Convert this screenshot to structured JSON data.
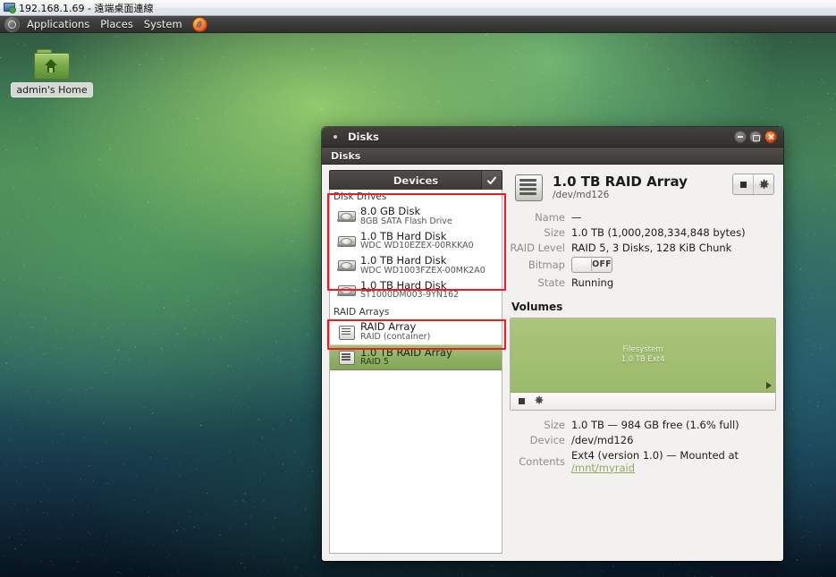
{
  "rdp": {
    "title": "192.168.1.69 - 遠端桌面連線",
    "icon": "remote-desktop-icon"
  },
  "desktop": {
    "menubar": {
      "logo_icon": "ubuntu-logo-icon",
      "items": [
        {
          "label": "Applications"
        },
        {
          "label": "Places"
        },
        {
          "label": "System"
        }
      ],
      "launcher_icon": "firefox-icon"
    },
    "home_icon": {
      "label": "admin's Home",
      "icon": "home-folder-icon"
    }
  },
  "window": {
    "title": "Disks",
    "menu_icon": "window-menu-icon",
    "buttons": {
      "minimize": "minimize-icon",
      "maximize": "maximize-icon",
      "close": "close-icon"
    },
    "app_header": "Disks"
  },
  "sidebar": {
    "header_label": "Devices",
    "header_check_icon": "check-icon",
    "groups": [
      {
        "title": "Disk Drives",
        "items": [
          {
            "name": "8.0 GB Disk",
            "model": "8GB SATA Flash Drive",
            "icon": "hard-disk-icon",
            "selected": false
          },
          {
            "name": "1.0 TB Hard Disk",
            "model": "WDC WD10EZEX-00RKKA0",
            "icon": "hard-disk-icon",
            "selected": false
          },
          {
            "name": "1.0 TB Hard Disk",
            "model": "WDC WD1003FZEX-00MK2A0",
            "icon": "hard-disk-icon",
            "selected": false
          },
          {
            "name": "1.0 TB Hard Disk",
            "model": "ST1000DM003-9YN162",
            "icon": "hard-disk-icon",
            "selected": false
          }
        ]
      },
      {
        "title": "RAID Arrays",
        "items": [
          {
            "name": "RAID Array",
            "model": "RAID (container)",
            "icon": "raid-array-icon",
            "selected": false
          },
          {
            "name": "1.0 TB RAID Array",
            "model": "RAID 5",
            "icon": "raid-array-icon",
            "selected": true
          }
        ]
      }
    ]
  },
  "detail": {
    "icon": "raid-array-icon",
    "title": "1.0 TB RAID Array",
    "subtitle": "/dev/md126",
    "actions": [
      {
        "name": "stop-array-button",
        "icon": "stop-square-icon"
      },
      {
        "name": "array-options-button",
        "icon": "gear-icon"
      }
    ],
    "properties": [
      {
        "label": "Name",
        "value": "—"
      },
      {
        "label": "Size",
        "value": "1.0 TB (1,000,208,334,848 bytes)"
      },
      {
        "label": "RAID Level",
        "value": "RAID 5, 3 Disks, 128 KiB Chunk"
      },
      {
        "label": "Bitmap",
        "value": "OFF",
        "type": "toggle"
      },
      {
        "label": "State",
        "value": "Running"
      }
    ]
  },
  "volumes": {
    "title": "Volumes",
    "strip": {
      "line1": "Filesystem",
      "line2": "1.0 TB Ext4",
      "color": "#a3c073"
    },
    "toolbar": [
      {
        "name": "unmount-volume-button",
        "icon": "stop-square-icon"
      },
      {
        "name": "volume-options-button",
        "icon": "gear-icon"
      }
    ],
    "properties": [
      {
        "label": "Size",
        "value": "1.0 TB — 984 GB free (1.6% full)"
      },
      {
        "label": "Device",
        "value": "/dev/md126"
      },
      {
        "label": "Contents",
        "value": "Ext4 (version 1.0) — Mounted at ",
        "link": "/mnt/myraid"
      }
    ]
  },
  "annotations": {
    "color": "#ed1c24",
    "boxes": [
      {
        "name": "disk-drives-highlight"
      },
      {
        "name": "selected-raid-highlight"
      }
    ]
  }
}
